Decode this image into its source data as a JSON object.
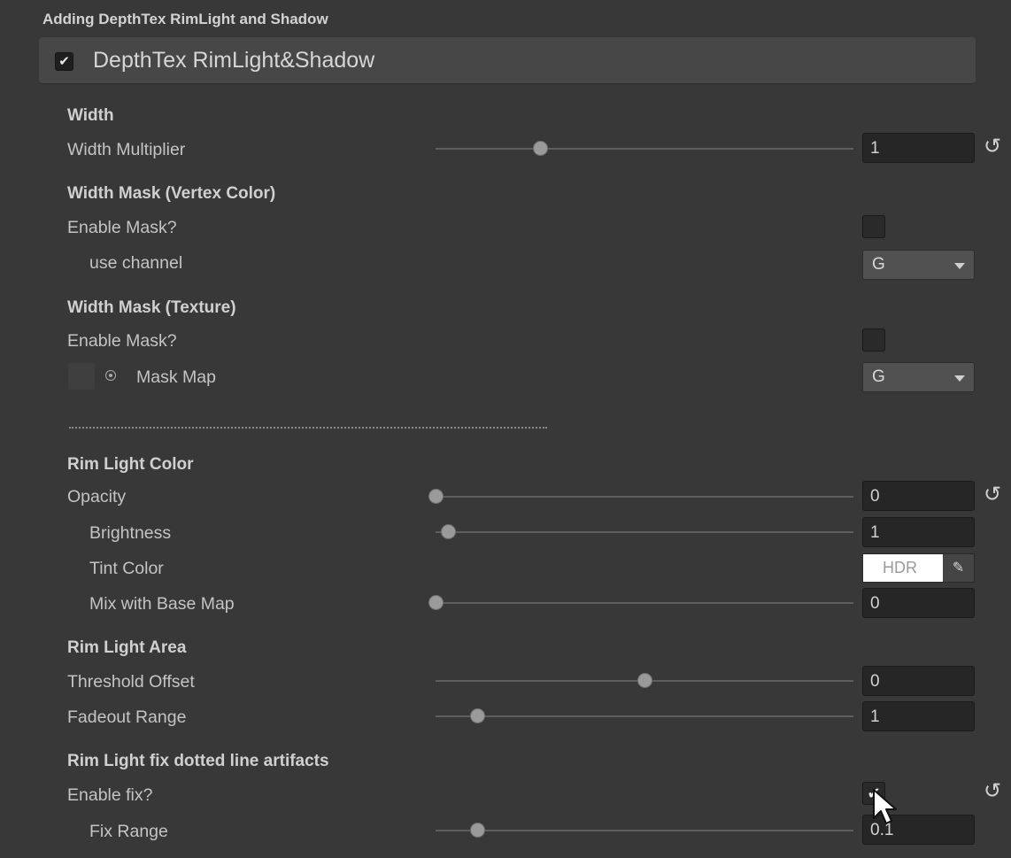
{
  "title": "Adding DepthTex RimLight and Shadow",
  "header": {
    "checkbox": "✔",
    "label": "DepthTex RimLight&Shadow"
  },
  "width": {
    "heading": "Width",
    "multiplier": {
      "label": "Width Multiplier",
      "value": "1",
      "slider_fraction": 0.25
    }
  },
  "width_mask_vertex": {
    "heading": "Width Mask (Vertex Color)",
    "enable_label": "Enable Mask?",
    "channel_label": "use channel",
    "channel_value": "G"
  },
  "width_mask_texture": {
    "heading": "Width Mask (Texture)",
    "enable_label": "Enable Mask?",
    "map_label": "Mask Map",
    "map_value": "G"
  },
  "rim_color": {
    "heading": "Rim Light Color",
    "opacity": {
      "label": "Opacity",
      "value": "0",
      "slider_fraction": 0.0
    },
    "brightness": {
      "label": "Brightness",
      "value": "1",
      "slider_fraction": 0.03
    },
    "tint": {
      "label": "Tint Color",
      "hdr": "HDR",
      "eyedropper": "✎"
    },
    "mix": {
      "label": "Mix with Base Map",
      "value": "0",
      "slider_fraction": 0.0
    }
  },
  "rim_area": {
    "heading": "Rim Light Area",
    "threshold": {
      "label": "Threshold Offset",
      "value": "0",
      "slider_fraction": 0.5
    },
    "fadeout": {
      "label": "Fadeout Range",
      "value": "1",
      "slider_fraction": 0.1
    }
  },
  "rim_fix": {
    "heading": "Rim Light fix dotted line artifacts",
    "enable_label": "Enable fix?",
    "enable_check": "✔",
    "range": {
      "label": "Fix Range",
      "value": "0.1",
      "slider_fraction": 0.1
    }
  },
  "icons": {
    "reset": "↺"
  }
}
